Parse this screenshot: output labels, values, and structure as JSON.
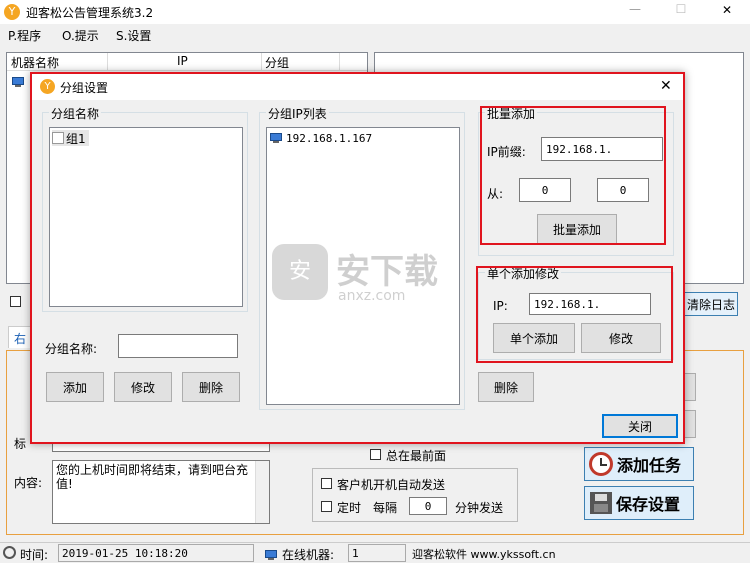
{
  "app": {
    "title": "迎客松公告管理系统3.2",
    "min": "—",
    "max": "☐",
    "close": "✕"
  },
  "menu": [
    "P.程序",
    "O.提示",
    "S.设置"
  ],
  "machine_table": {
    "headers": [
      "机器名称",
      "IP",
      "分组"
    ]
  },
  "bg": {
    "tab_label": "右",
    "clear_log": "清除日志",
    "label_biao": "标",
    "content_label": "内容:",
    "content_text": "您的上机时间即将结束，请到吧台充值!",
    "always_top": "总在最前面",
    "auto_send": "客户机开机自动发送",
    "timed": "定时",
    "every": "每隔",
    "interval": "0",
    "minutes_send": "分钟发送",
    "add_task": "添加任务",
    "save_settings": "保存设置"
  },
  "status": {
    "time_label": "时间:",
    "time_value": "2019-01-25 10:18:20",
    "online_label": "在线机器:",
    "online_value": "1",
    "company": "迎客松软件 www.ykssoft.cn"
  },
  "dialog": {
    "title": "分组设置",
    "close": "✕",
    "group_name_title": "分组名称",
    "groups": [
      "组1"
    ],
    "group_ip_title": "分组IP列表",
    "ips": [
      "192.168.1.167"
    ],
    "group_name_label": "分组名称:",
    "group_name_value": "",
    "add": "添加",
    "modify": "修改",
    "delete": "删除",
    "batch_title": "批量添加",
    "ip_prefix_label": "IP前缀:",
    "ip_prefix_value": "192.168.1.",
    "from_label": "从:",
    "from_value": "0",
    "to_value": "0",
    "batch_add": "批量添加",
    "single_title": "单个添加修改",
    "ip_label": "IP:",
    "ip_value": "192.168.1.",
    "single_add": "单个添加",
    "single_modify": "修改",
    "ip_delete": "删除",
    "close_btn": "关闭"
  },
  "watermark": {
    "cn": "安下载",
    "en": "anxz.com"
  }
}
